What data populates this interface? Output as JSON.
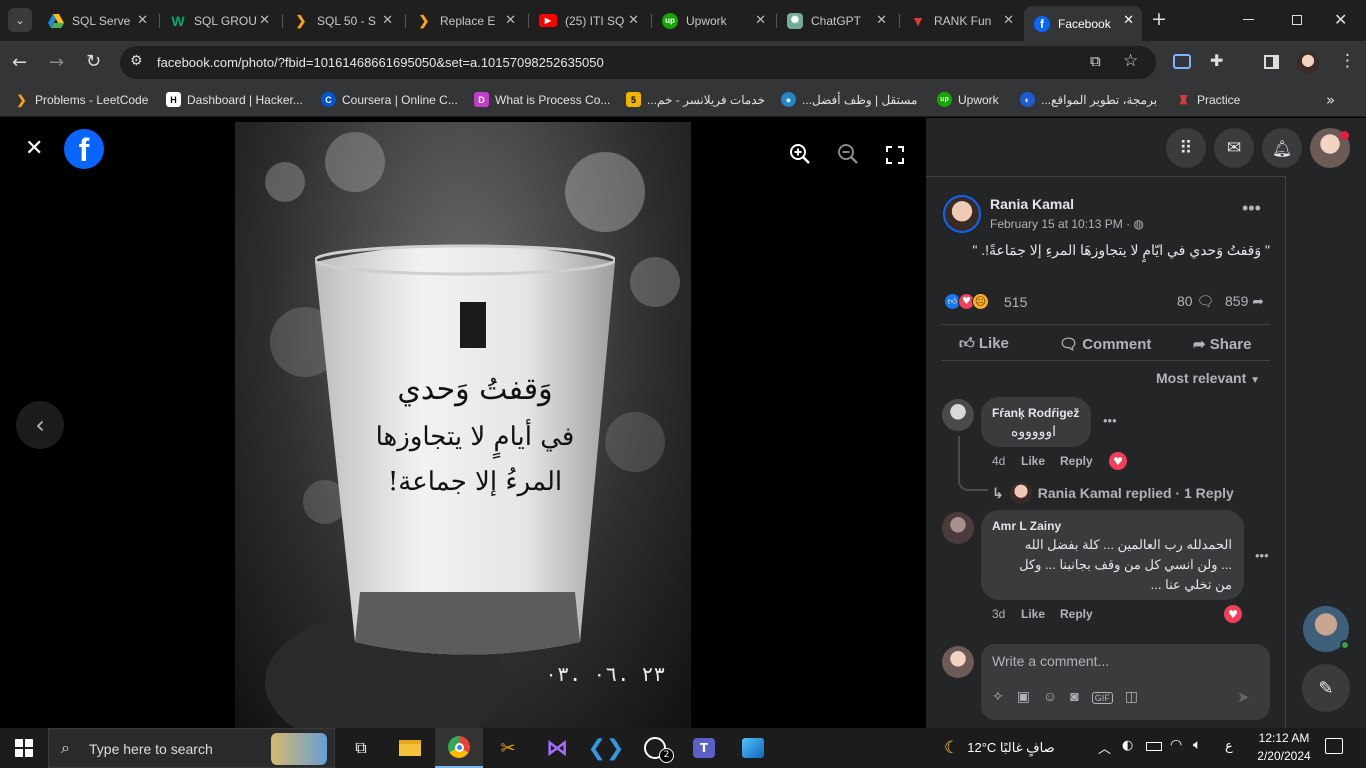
{
  "tabs": [
    {
      "title": "SQL Serve",
      "icon": "google-drive-icon"
    },
    {
      "title": "SQL GROU",
      "icon": "w3schools-icon"
    },
    {
      "title": "SQL 50 - S",
      "icon": "leetcode-icon"
    },
    {
      "title": "Replace E",
      "icon": "leetcode-icon"
    },
    {
      "title": "(25) ITI SQ",
      "icon": "youtube-icon"
    },
    {
      "title": "Upwork",
      "icon": "upwork-icon"
    },
    {
      "title": "ChatGPT",
      "icon": "chatgpt-icon"
    },
    {
      "title": "RANK Fun",
      "icon": "rank-icon"
    },
    {
      "title": "Facebook",
      "icon": "facebook-icon"
    }
  ],
  "address": {
    "url": "facebook.com/photo/?fbid=10161468661695050&set=a.10157098252635050"
  },
  "bookmarks": [
    {
      "label": "Problems - LeetCode"
    },
    {
      "label": "Dashboard | Hacker..."
    },
    {
      "label": "Coursera | Online C..."
    },
    {
      "label": "What is Process Co..."
    },
    {
      "label": "خدمات فريلانسر - خم..."
    },
    {
      "label": "مستقل | وظف أفضل..."
    },
    {
      "label": "Upwork"
    },
    {
      "label": "برمجة، تطوير المواقع..."
    },
    {
      "label": "Practice"
    }
  ],
  "photo": {
    "line1": "وَقفتُ وَحدي",
    "line2": "في أيامٍ لا يتجاوزها",
    "line3": "المرءُ إلا جماعة!",
    "date": "٢٣ .٠٦ .٠٣"
  },
  "post": {
    "author": "Rania Kamal",
    "timestamp": "February 15 at 10:13 PM · ",
    "caption": "\" وَقفتُ وَحدي في ايّامٍ لا يتجاوزهَا المرءِ إلا جمَاعةً!. \"",
    "reactions_count": "515",
    "comments_count": "80",
    "shares_count": "859",
    "like_label": "Like",
    "comment_label": "Comment",
    "share_label": "Share",
    "sort_label": "Most relevant"
  },
  "comments": [
    {
      "author": "Fŕanķ Rodŕigež",
      "text": "اوووووه",
      "age": "4d",
      "like": "Like",
      "reply": "Reply",
      "replies_summary": "Rania Kamal replied · 1 Reply"
    },
    {
      "author": "Amr L Zainy",
      "line1": "الحمدلله رب العالمين ... كلة بفضل الله",
      "line2": "... ولن انسي كل من وقف بجانبنا ... وكل",
      "line3": "من تخلي عنا ...",
      "age": "3d",
      "like": "Like",
      "reply": "Reply"
    }
  ],
  "composer": {
    "placeholder": "Write a comment..."
  },
  "taskbar": {
    "search_placeholder": "Type here to search",
    "weather": "12°C  صافٍ غالبًا",
    "lang": "ع",
    "time": "12:12 AM",
    "date": "2/20/2024",
    "whatsapp_badge": "2"
  },
  "colors": {
    "facebook_blue": "#0866ff",
    "panel_bg": "#242526",
    "bubble_bg": "#3a3b3c",
    "chrome_dark": "#1f1f1f",
    "chrome_toolbar": "#333537"
  }
}
